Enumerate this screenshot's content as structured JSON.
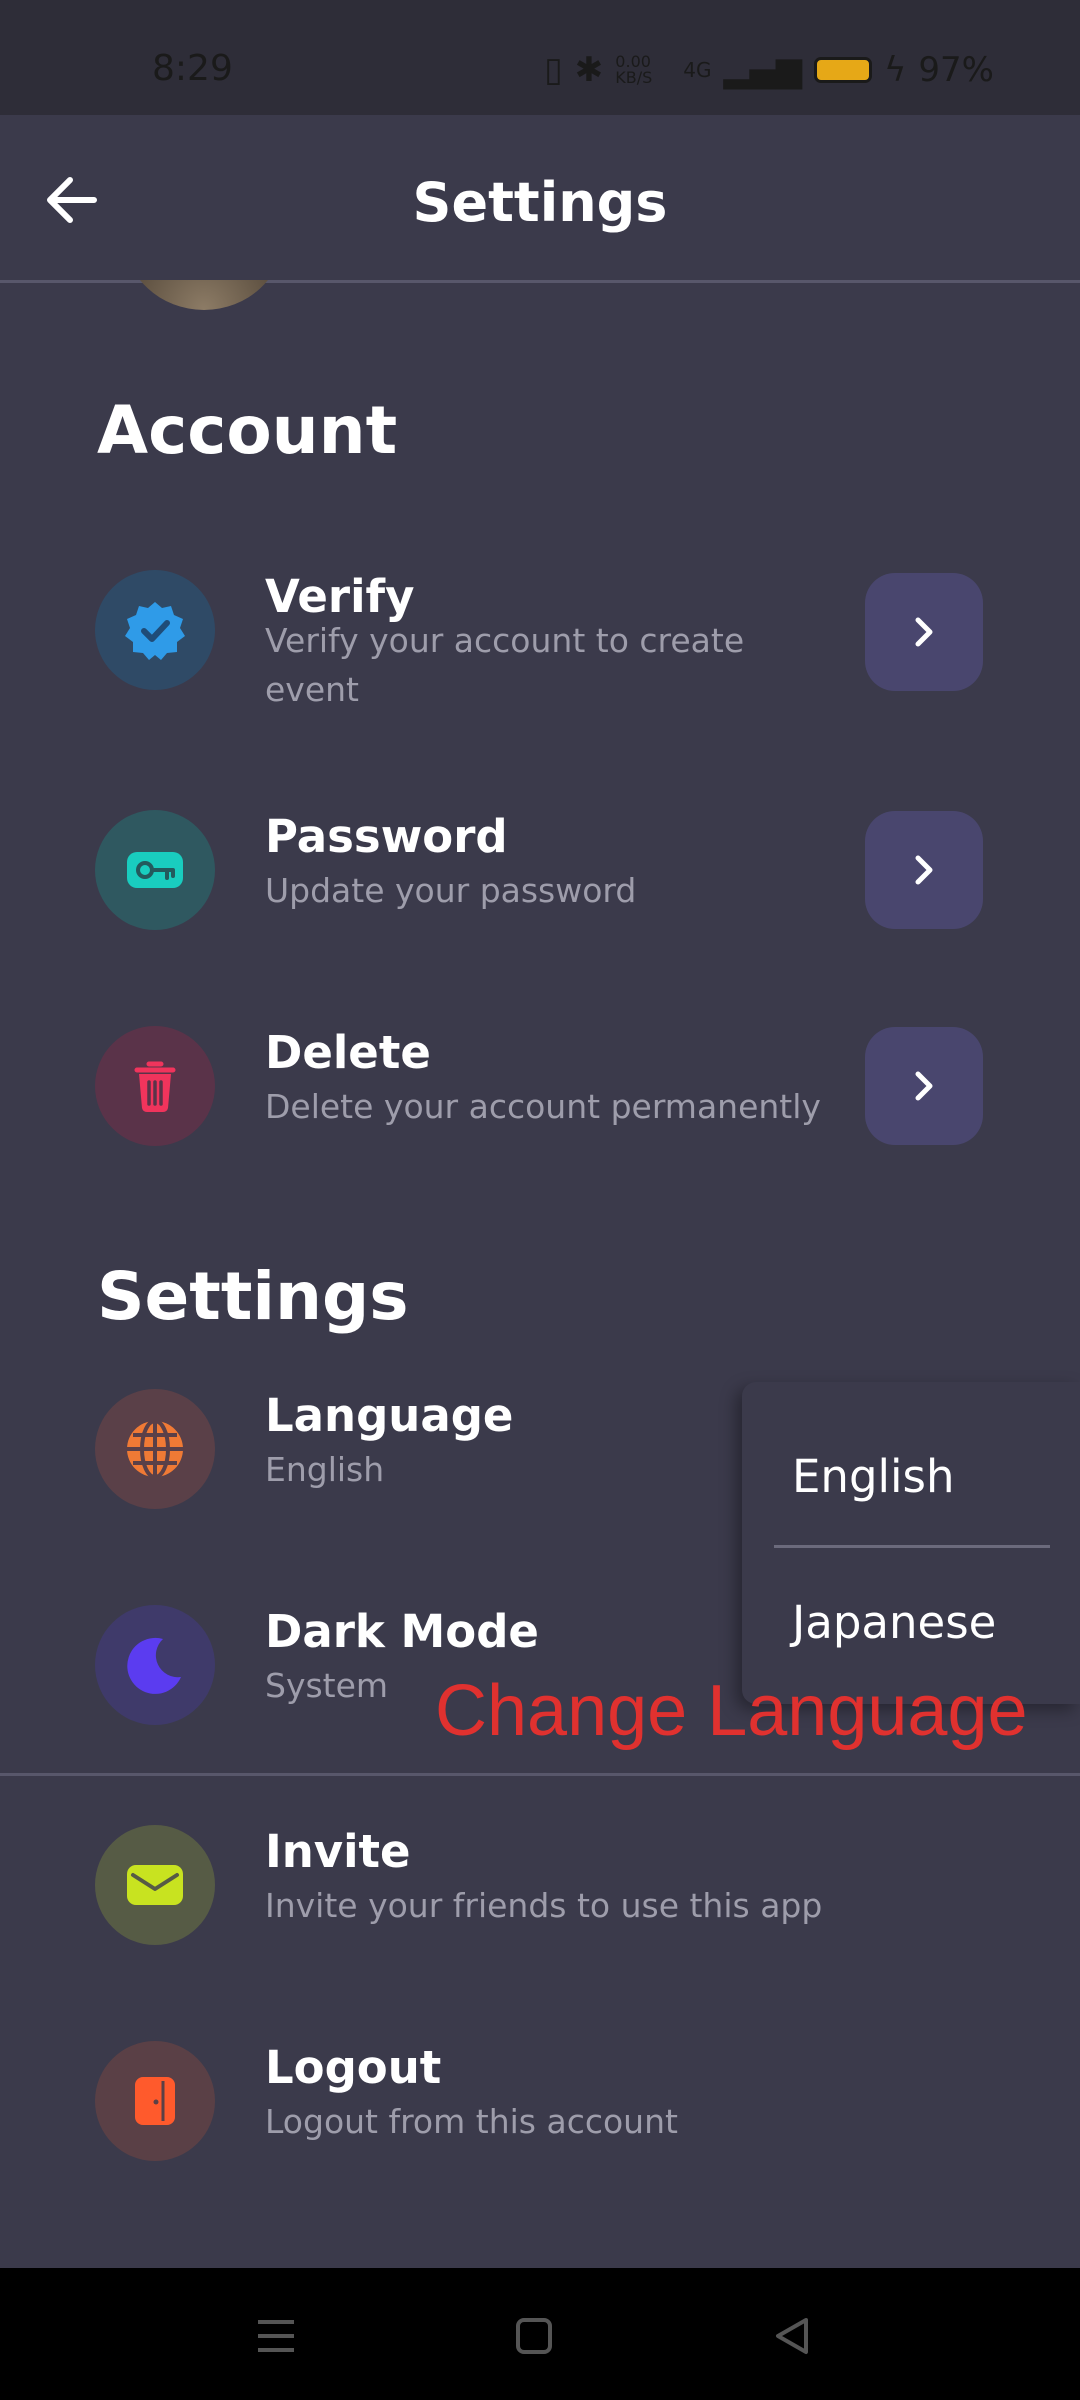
{
  "status_bar": {
    "time": "8:29",
    "net_speed": "0.00 KB/S",
    "network": "4G",
    "battery": "97%"
  },
  "header": {
    "title": "Settings"
  },
  "account_section": {
    "title": "Account",
    "items": [
      {
        "title": "Verify",
        "subtitle": "Verify your account to create event",
        "icon": "verified-badge-icon",
        "icon_color": "#2f9be8"
      },
      {
        "title": "Password",
        "subtitle": "Update your password",
        "icon": "key-icon",
        "icon_color": "#19cdbf"
      },
      {
        "title": "Delete",
        "subtitle": "Delete your account permanently",
        "icon": "trash-icon",
        "icon_color": "#f0345c"
      }
    ]
  },
  "settings_section": {
    "title": "Settings",
    "items": [
      {
        "title": "Language",
        "subtitle": "English",
        "icon": "globe-icon",
        "icon_color": "#f07a35"
      },
      {
        "title": "Dark Mode",
        "subtitle": "System",
        "icon": "moon-icon",
        "icon_color": "#5b3cf0"
      }
    ]
  },
  "other_items": [
    {
      "title": "Invite",
      "subtitle": "Invite your friends to use this app",
      "icon": "envelope-icon",
      "icon_color": "#c8e320"
    },
    {
      "title": "Logout",
      "subtitle": "Logout from this account",
      "icon": "logout-door-icon",
      "icon_color": "#ff5a2c"
    }
  ],
  "language_menu": {
    "options": [
      "English",
      "Japanese"
    ]
  },
  "annotation": {
    "text": "Change Language",
    "color": "#e0312f"
  }
}
